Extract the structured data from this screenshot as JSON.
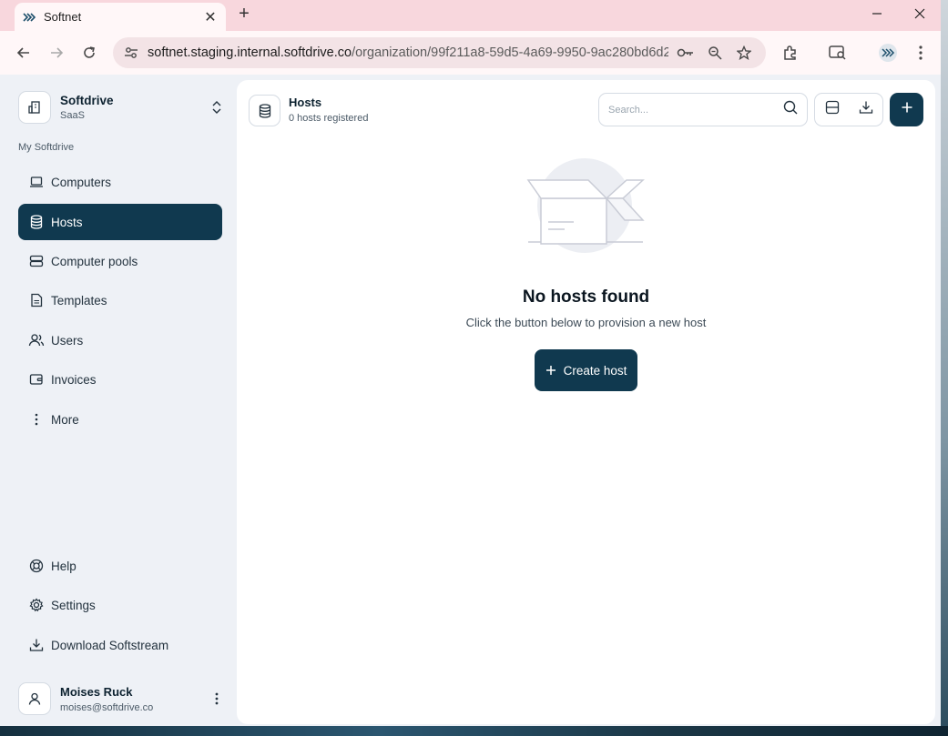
{
  "browser": {
    "tab_title": "Softnet",
    "url_host": "softnet.staging.internal.softdrive.co",
    "url_path": "/organization/99f211a8-59d5-4a69-9950-9ac280bd6d2..."
  },
  "sidebar": {
    "org_name": "Softdrive",
    "org_plan": "SaaS",
    "section_label": "My Softdrive",
    "items": [
      {
        "label": "Computers",
        "icon": "laptop-icon"
      },
      {
        "label": "Hosts",
        "icon": "database-icon",
        "active": true
      },
      {
        "label": "Computer pools",
        "icon": "server-icon"
      },
      {
        "label": "Templates",
        "icon": "document-icon"
      },
      {
        "label": "Users",
        "icon": "users-icon"
      },
      {
        "label": "Invoices",
        "icon": "wallet-icon"
      },
      {
        "label": "More",
        "icon": "more-vertical-icon"
      }
    ],
    "bottom_items": [
      {
        "label": "Help",
        "icon": "lifebuoy-icon"
      },
      {
        "label": "Settings",
        "icon": "gear-icon"
      },
      {
        "label": "Download Softstream",
        "icon": "download-icon"
      }
    ],
    "user_name": "Moises Ruck",
    "user_email": "moises@softdrive.co"
  },
  "header": {
    "title": "Hosts",
    "subtitle": "0 hosts registered",
    "search_placeholder": "Search..."
  },
  "empty_state": {
    "title": "No hosts found",
    "subtitle": "Click the button below to provision a new host",
    "button_label": "Create host"
  },
  "colors": {
    "accent": "#10394f",
    "sidebar_bg": "#eef1f6",
    "browser_frame": "#f8d7dd"
  }
}
